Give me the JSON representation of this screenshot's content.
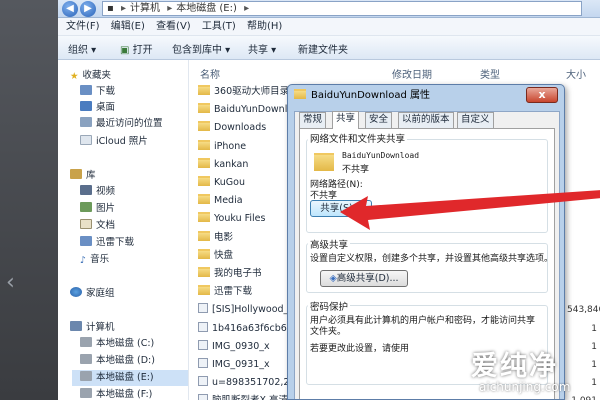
{
  "address": {
    "segments": [
      "计算机",
      "本地磁盘 (E:)"
    ]
  },
  "menubar": {
    "items": [
      "文件(F)",
      "编辑(E)",
      "查看(V)",
      "工具(T)",
      "帮助(H)"
    ]
  },
  "toolbar": {
    "organize": "组织 ▾",
    "open": "打开",
    "include": "包含到库中 ▾",
    "share": "共享 ▾",
    "new_folder": "新建文件夹"
  },
  "nav": {
    "favorites": "收藏夹",
    "downloads": "下载",
    "desktop": "桌面",
    "recent": "最近访问的位置",
    "icloud": "iCloud 照片",
    "libraries": "库",
    "videos": "视频",
    "pictures": "图片",
    "documents": "文档",
    "thunder": "迅雷下载",
    "music": "音乐",
    "homegroup": "家庭组",
    "computer": "计算机",
    "drive_c": "本地磁盘 (C:)",
    "drive_d": "本地磁盘 (D:)",
    "drive_e": "本地磁盘 (E:)",
    "drive_f": "本地磁盘 (F:)"
  },
  "columns": {
    "name": "名称",
    "modified": "修改日期",
    "type": "类型",
    "size": "大小"
  },
  "files": [
    {
      "name": "360驱动大师目录",
      "size": ""
    },
    {
      "name": "BaiduYunDownload",
      "size": ""
    },
    {
      "name": "Downloads",
      "size": ""
    },
    {
      "name": "iPhone",
      "size": ""
    },
    {
      "name": "kankan",
      "size": ""
    },
    {
      "name": "KuGou",
      "size": ""
    },
    {
      "name": "Media",
      "size": ""
    },
    {
      "name": "Youku Files",
      "size": ""
    },
    {
      "name": "电影",
      "size": ""
    },
    {
      "name": "快盘",
      "size": ""
    },
    {
      "name": "我的电子书",
      "size": ""
    },
    {
      "name": "迅雷下载",
      "size": ""
    },
    {
      "name": "[SIS]Hollywood_C",
      "size": "543,846"
    },
    {
      "name": "1b416a63f6cb6b",
      "size": "1"
    },
    {
      "name": "IMG_0930_x",
      "size": "1"
    },
    {
      "name": "IMG_0931_x",
      "size": "1"
    },
    {
      "name": "u=898351702,27",
      "size": "1"
    },
    {
      "name": "脑肌断裂者X 高清",
      "size": "1,091"
    }
  ],
  "dialog": {
    "title": "BaiduYunDownload 属性",
    "close": "x",
    "tabs": [
      "常规",
      "共享",
      "安全",
      "以前的版本",
      "自定义"
    ],
    "net_share_group": "网络文件和文件夹共享",
    "folder_name": "BaiduYunDownload",
    "folder_status": "不共享",
    "net_path_label": "网络路径(N):",
    "net_path_value": "不共享",
    "share_button": "共享(S)...",
    "advanced_group": "高级共享",
    "advanced_desc": "设置自定义权限，创建多个共享，并设置其他高级共享选项。",
    "advanced_button": "高级共享(D)...",
    "password_group": "密码保护",
    "password_desc_1": "用户必须具有此计算机的用户帐户和密码，才能访问共享",
    "password_desc_2": "文件夹。",
    "password_link": "若要更改此设置，请使用"
  },
  "watermark": {
    "brand": "爱纯净",
    "url": "aichunjing.com"
  },
  "colors": {
    "arrow": "#e0282b",
    "selection": "#cde1f7",
    "dialog_frame": "#b8d0ea"
  }
}
